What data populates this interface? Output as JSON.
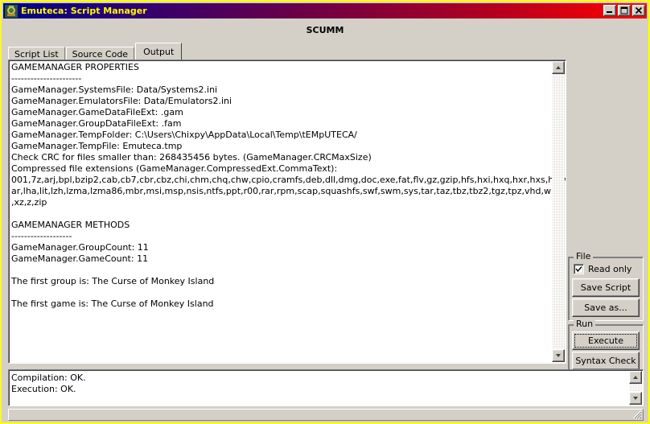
{
  "window": {
    "title": "Emuteca: Script Manager",
    "icon": "app-icon",
    "titlebar_accent": "#ffff00",
    "face_color": "#d4d0c8",
    "controls": [
      {
        "name": "minimize-button",
        "glyph": "_"
      },
      {
        "name": "maximize-button",
        "glyph": "□"
      },
      {
        "name": "close-button",
        "glyph": "×"
      }
    ]
  },
  "header": {
    "title": "SCUMM"
  },
  "tabs": [
    {
      "label": "Script List",
      "active": false
    },
    {
      "label": "Source Code",
      "active": false
    },
    {
      "label": "Output",
      "active": true
    }
  ],
  "output": {
    "text": "GAMEMANAGER PROPERTIES\n----------------------\nGameManager.SystemsFile: Data/Systems2.ini\nGameManager.EmulatorsFile: Data/Emulators2.ini\nGameManager.GameDataFileExt: .gam\nGameManager.GroupDataFileExt: .fam\nGameManager.TempFolder: C:\\Users\\Chixpy\\AppData\\Local\\Temp\\tEMpUTECA/\nGameManager.TempFile: Emuteca.tmp\nCheck CRC for files smaller than: 268435456 bytes. (GameManager.CRCMaxSize)\nCompressed file extensions (GameManager.CompressedExt.CommaText):\n001,7z,arj,bpl,bzip2,cab,cb7,cbr,cbz,chi,chm,chq,chw,cpio,cramfs,deb,dll,dmg,doc,exe,fat,flv,gz,gzip,hfs,hxi,hxq,hxr,hxs,hxw,img,iso,j\nar,lha,lit,lzh,lzma,lzma86,mbr,msi,msp,nsis,ntfs,ppt,r00,rar,rpm,scap,squashfs,swf,swm,sys,tar,taz,tbz,tbz2,tgz,tpz,vhd,wim,xar,xls,xpi\n,xz,z,zip\n\nGAMEMANAGER METHODS\n-------------------\nGameManager.GroupCount: 11\nGameManager.GameCount: 11\n\nThe first group is: The Curse of Monkey Island\n\nThe first game is: The Curse of Monkey Island",
    "scrollbar": {
      "up_arrow": "scroll-up-icon",
      "down_arrow": "scroll-down-icon"
    }
  },
  "side_panel": {
    "file_group": {
      "title": "File",
      "read_only": {
        "label": "Read only",
        "checked": true
      },
      "save_script": "Save Script",
      "save_as": "Save as..."
    },
    "run_group": {
      "title": "Run",
      "execute": "Execute",
      "syntax_check": "Syntax Check"
    }
  },
  "log": {
    "text": "Compilation: OK.\nExecution: OK.",
    "scrollbar": {
      "up_arrow": "scroll-up-icon",
      "down_arrow": "scroll-down-icon"
    }
  },
  "statusbar": {
    "text": ""
  }
}
